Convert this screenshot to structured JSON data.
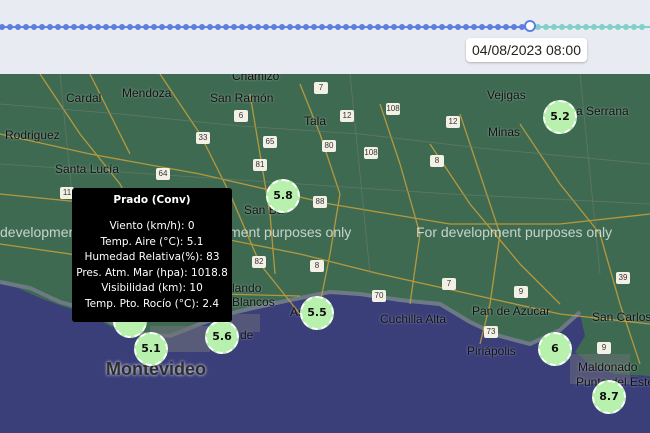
{
  "timeline": {
    "selected_time": "04/08/2023 08:00",
    "progress": 0.815
  },
  "colors": {
    "track_active": "#5f7fe0",
    "track_rest": "#7fd0c8",
    "marker_fill": "#b8f0ae",
    "land": "#3f6a52",
    "water": "#3a3f7a"
  },
  "map": {
    "watermarks": [
      "development purposes only",
      "For development purposes only"
    ],
    "places": [
      {
        "name": "Chamizo",
        "key": "chamizo"
      },
      {
        "name": "Cardal",
        "key": "cardal"
      },
      {
        "name": "Mendoza",
        "key": "mendoza"
      },
      {
        "name": "San Ramón",
        "key": "san-ramon"
      },
      {
        "name": "Tala",
        "key": "tala"
      },
      {
        "name": "Vejigas",
        "key": "vejigas"
      },
      {
        "name": "a Serrana",
        "key": "serrana"
      },
      {
        "name": "Rodriguez",
        "key": "rodriguez"
      },
      {
        "name": "Minas",
        "key": "minas"
      },
      {
        "name": "Santa Lucía",
        "key": "santa-lucia"
      },
      {
        "name": "San Ba",
        "key": "san-bautista"
      },
      {
        "name": "Cuchilla Alta",
        "key": "cuchilla-alta"
      },
      {
        "name": "Pan de Azúcar",
        "key": "pan-de-azucar"
      },
      {
        "name": "San Carlos",
        "key": "san-carlos"
      },
      {
        "name": "Piriápolis",
        "key": "piriapolis"
      },
      {
        "name": "Montevideo",
        "key": "montevideo"
      },
      {
        "name": "Maldonado",
        "key": "maldonado"
      },
      {
        "name": "Punta del Este",
        "key": "punta-del-este"
      },
      {
        "name": "lando",
        "key": "lando"
      },
      {
        "name": "Blancos",
        "key": "blancos"
      },
      {
        "name": "de",
        "key": "de"
      },
      {
        "name": "As",
        "key": "as"
      }
    ],
    "routes": [
      "7",
      "6",
      "108",
      "12",
      "65",
      "33",
      "12",
      "80",
      "81",
      "64",
      "108",
      "8",
      "88",
      "81",
      "11",
      "82",
      "8",
      "7",
      "70",
      "9",
      "39",
      "73",
      "9"
    ]
  },
  "stations": [
    {
      "value": "5.2",
      "key": "minas-station"
    },
    {
      "value": "5.8",
      "key": "san-bautista-station"
    },
    {
      "value": "5.5",
      "key": "atlantida-station"
    },
    {
      "value": "5.6",
      "key": "carrasco-station"
    },
    {
      "value": "5.1",
      "key": "montevideo-station"
    },
    {
      "value": "6",
      "key": "punta-ballena-station"
    },
    {
      "value": "8.7",
      "key": "punta-del-este-station"
    },
    {
      "value": "",
      "key": "prado-station"
    }
  ],
  "tooltip": {
    "title": "Prado (Conv)",
    "rows": [
      "Viento (km/h): 0",
      "Temp. Aire (°C): 5.1",
      "Humedad Relativa(%): 83",
      "Pres. Atm. Mar (hpa): 1018.8",
      "Visibilidad (km): 10",
      "Temp. Pto. Rocío (°C): 2.4"
    ]
  }
}
